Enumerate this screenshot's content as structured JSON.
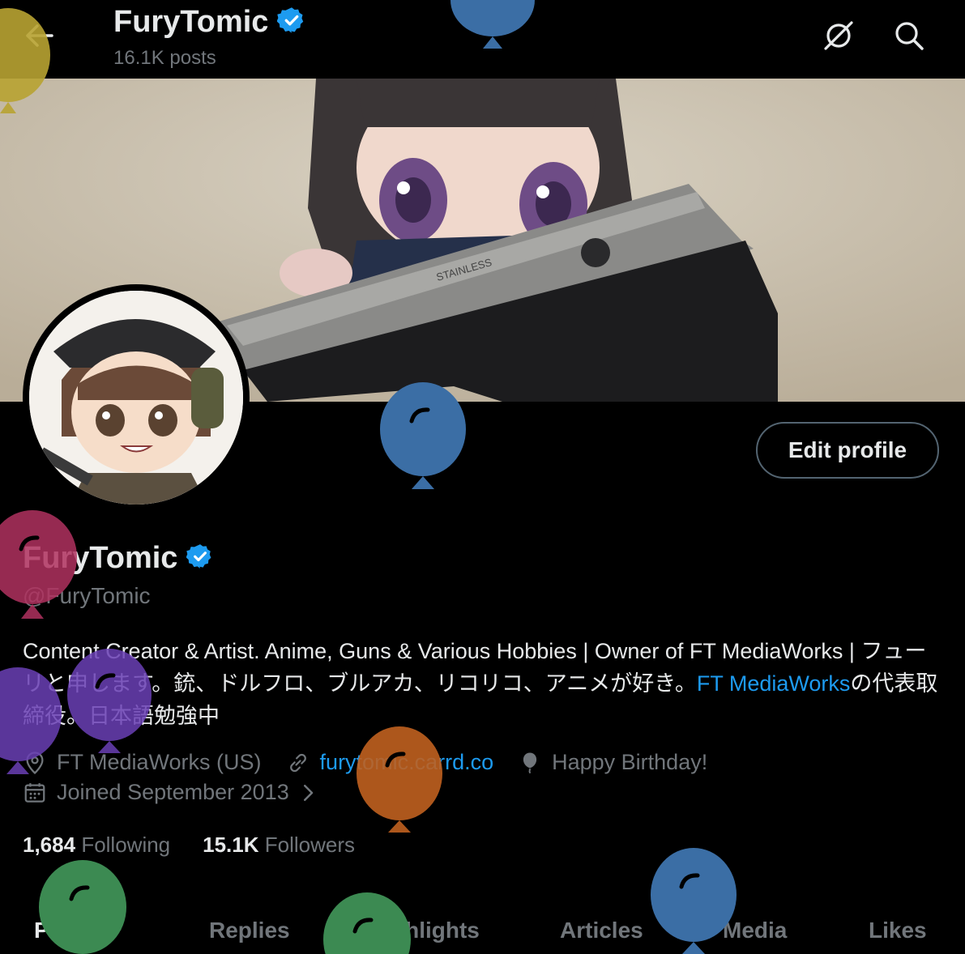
{
  "header": {
    "title": "FuryTomic",
    "posts_count": "16.1K posts"
  },
  "profile": {
    "name": "FuryTomic",
    "handle": "@FuryTomic",
    "edit_button": "Edit profile",
    "bio_part1": "Content Creator & Artist. Anime, Guns & Various Hobbies | Owner of FT MediaWorks | フューリと申します。銃、ドルフロ、ブルアカ、リコリコ、アニメが好き。",
    "bio_mention": "FT MediaWorks",
    "bio_part2": "の代表取締役。日本語勉強中",
    "location": "FT MediaWorks (US)",
    "website": "furytomic.carrd.co",
    "birthday": "Happy Birthday!",
    "joined": "Joined September 2013",
    "following_count": "1,684",
    "following_label": "Following",
    "followers_count": "15.1K",
    "followers_label": "Followers"
  },
  "tabs": [
    {
      "label": "Posts"
    },
    {
      "label": "Replies"
    },
    {
      "label": "Highlights"
    },
    {
      "label": "Articles"
    },
    {
      "label": "Media"
    },
    {
      "label": "Likes"
    }
  ],
  "colors": {
    "accent": "#1d9bf0",
    "verified": "#1d9bf0",
    "balloon_blue": "#3b6ea5",
    "balloon_yellow": "#b8a332",
    "balloon_magenta": "#b0315f",
    "balloon_purple": "#6a3fb5",
    "balloon_orange": "#c0601f",
    "balloon_green": "#3c8a52"
  },
  "icons": {
    "back": "arrow-left-icon",
    "grok": "grok-icon",
    "search": "search-icon",
    "location": "location-pin-icon",
    "link": "link-icon",
    "balloon": "balloon-icon",
    "calendar": "calendar-icon"
  }
}
